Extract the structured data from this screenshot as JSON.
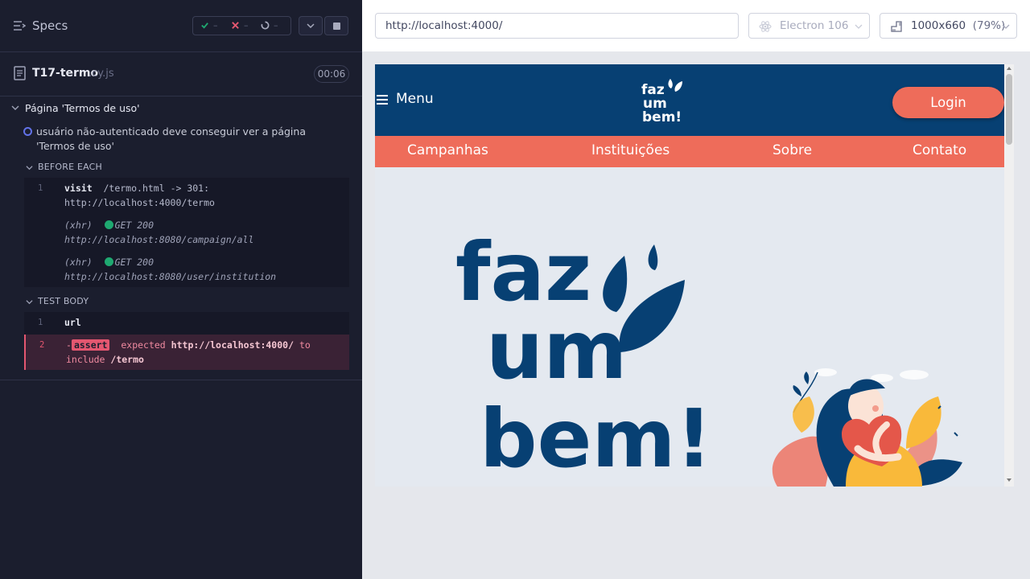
{
  "reporter": {
    "header": {
      "title": "Specs",
      "icon": "specs-list-icon"
    },
    "stats": {
      "passed": "–",
      "failed": "–",
      "pending": "–"
    },
    "controls": {
      "collapse_icon": "chevron-down-icon",
      "stop_icon": "stop-icon"
    },
    "spec_file": {
      "name": "T17-termo",
      "ext": ".cy.js",
      "duration": "00:06"
    },
    "suite": {
      "title": "Página 'Termos de uso'",
      "test_title": "usuário não-autenticado deve conseguir ver a página 'Termos de uso'"
    },
    "before_each": {
      "label": "BEFORE EACH",
      "commands": [
        {
          "num": "1",
          "name": "visit",
          "arg": "/termo.html -> 301:",
          "arg2": "http://localhost:4000/termo"
        },
        {
          "tag": "(xhr)",
          "status": "GET 200",
          "url": "http://localhost:8080/campaign/all"
        },
        {
          "tag": "(xhr)",
          "status": "GET 200",
          "url": "http://localhost:8080/user/institution"
        }
      ]
    },
    "test_body": {
      "label": "TEST BODY",
      "commands": [
        {
          "num": "1",
          "name": "url"
        },
        {
          "num": "2",
          "prefix": "-",
          "name": "assert",
          "w1": "expected",
          "v1": "http://localhost:4000/",
          "w2": "to",
          "w3": "include",
          "v2": "/termo"
        }
      ]
    }
  },
  "aut": {
    "url": "http://localhost:4000/",
    "browser": "Electron 106",
    "viewport": {
      "size": "1000x660",
      "scale": "(79%)"
    },
    "site": {
      "menu_label": "Menu",
      "logo_text": [
        "faz",
        "um",
        "bem!"
      ],
      "login_label": "Login",
      "nav": [
        "Campanhas",
        "Instituições",
        "Sobre",
        "Contato"
      ],
      "hero_logo_text": [
        "faz",
        "um",
        "bem!"
      ],
      "colors": {
        "primary": "#074073",
        "accent": "#ee6c5a",
        "background": "#e4e9f0"
      }
    }
  }
}
